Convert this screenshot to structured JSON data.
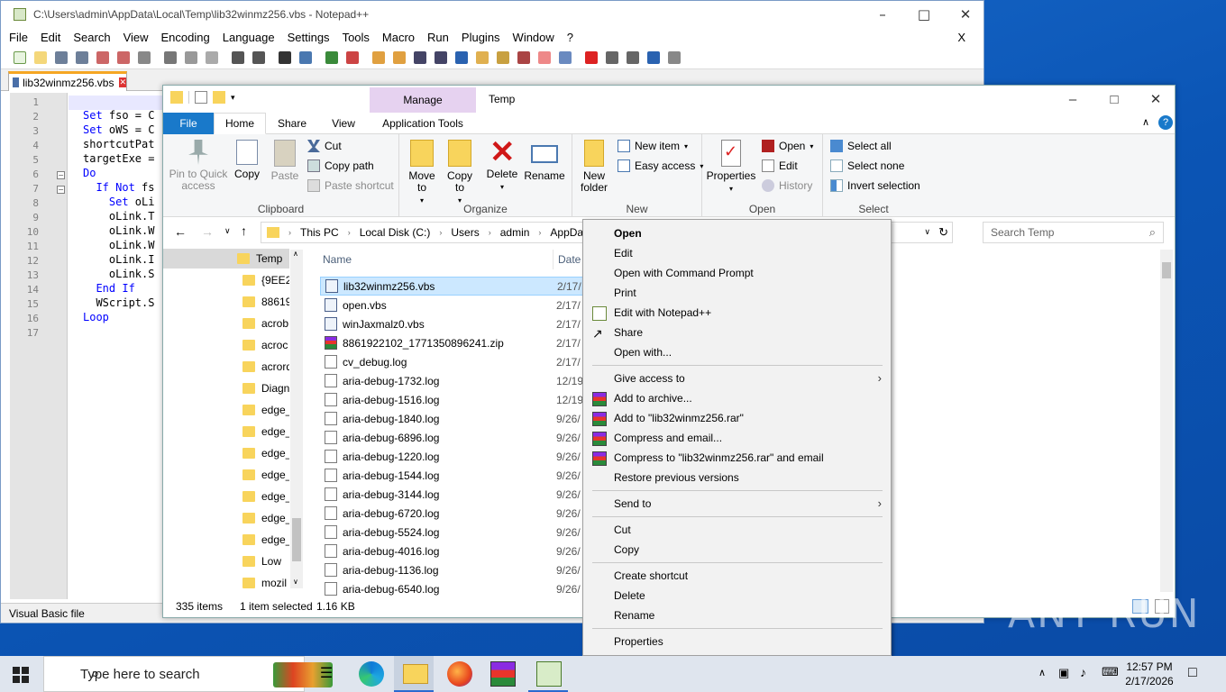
{
  "npp": {
    "title": "C:\\Users\\admin\\AppData\\Local\\Temp\\lib32winmz256.vbs - Notepad++",
    "menu": [
      "File",
      "Edit",
      "Search",
      "View",
      "Encoding",
      "Language",
      "Settings",
      "Tools",
      "Macro",
      "Run",
      "Plugins",
      "Window",
      "?"
    ],
    "menu_close": "X",
    "tab": "lib32winmz256.vbs",
    "line_numbers": [
      "1",
      "2",
      "3",
      "4",
      "5",
      "6",
      "7",
      "8",
      "9",
      "10",
      "11",
      "12",
      "13",
      "14",
      "15",
      "16",
      "17"
    ],
    "code_lines": [
      {
        "kw": "",
        "text": ""
      },
      {
        "kw": "Set",
        "text": " fso = C"
      },
      {
        "kw": "Set",
        "text": " oWS = C"
      },
      {
        "kw": "",
        "text": "shortcutPat"
      },
      {
        "kw": "",
        "text": "targetExe ="
      },
      {
        "kw": "Do",
        "text": ""
      },
      {
        "kw": "  If Not",
        "text": " fs"
      },
      {
        "kw": "    Set",
        "text": " oLi"
      },
      {
        "kw": "",
        "text": "    oLink.T"
      },
      {
        "kw": "",
        "text": "    oLink.W"
      },
      {
        "kw": "",
        "text": "    oLink.W"
      },
      {
        "kw": "",
        "text": "    oLink.I"
      },
      {
        "kw": "",
        "text": "    oLink.S"
      },
      {
        "kw": "  End If",
        "text": ""
      },
      {
        "kw": "",
        "text": "  WScript.S"
      },
      {
        "kw": "Loop",
        "text": ""
      },
      {
        "kw": "",
        "text": ""
      }
    ],
    "status_lang": "Visual Basic file"
  },
  "explorer": {
    "manage": "Manage",
    "title": "Temp",
    "tabs": {
      "file": "File",
      "home": "Home",
      "share": "Share",
      "view": "View",
      "app_tools": "Application Tools"
    },
    "clipboard": {
      "pin": "Pin to Quick access",
      "copy": "Copy",
      "paste": "Paste",
      "cut": "Cut",
      "copy_path": "Copy path",
      "paste_shortcut": "Paste shortcut",
      "label": "Clipboard"
    },
    "organize": {
      "move_to": "Move to",
      "copy_to": "Copy to",
      "delete": "Delete",
      "rename": "Rename",
      "label": "Organize"
    },
    "new": {
      "new_folder": "New folder",
      "new_item": "New item",
      "easy_access": "Easy access",
      "label": "New"
    },
    "open": {
      "properties": "Properties",
      "open": "Open",
      "edit": "Edit",
      "history": "History",
      "label": "Open"
    },
    "select": {
      "select_all": "Select all",
      "select_none": "Select none",
      "invert": "Invert selection",
      "label": "Select"
    },
    "breadcrumb": [
      "This PC",
      "Local Disk (C:)",
      "Users",
      "admin",
      "AppData"
    ],
    "search_placeholder": "Search Temp",
    "nav_items": [
      "Temp",
      "{9EE29",
      "88619",
      "acrob",
      "acroc",
      "acrord",
      "Diagn",
      "edge_",
      "edge_",
      "edge_",
      "edge_",
      "edge_",
      "edge_",
      "edge_",
      "Low",
      "mozil"
    ],
    "columns": {
      "name": "Name",
      "date": "Date"
    },
    "files": [
      {
        "name": "lib32winmz256.vbs",
        "date": "2/17/",
        "type": "vbs"
      },
      {
        "name": "open.vbs",
        "date": "2/17/",
        "type": "vbs"
      },
      {
        "name": "winJaxmalz0.vbs",
        "date": "2/17/",
        "type": "vbs"
      },
      {
        "name": "8861922102_1771350896241.zip",
        "date": "2/17/",
        "type": "zip"
      },
      {
        "name": "cv_debug.log",
        "date": "2/17/",
        "type": "log"
      },
      {
        "name": "aria-debug-1732.log",
        "date": "12/19",
        "type": "log"
      },
      {
        "name": "aria-debug-1516.log",
        "date": "12/19",
        "type": "log"
      },
      {
        "name": "aria-debug-1840.log",
        "date": "9/26/",
        "type": "log"
      },
      {
        "name": "aria-debug-6896.log",
        "date": "9/26/",
        "type": "log"
      },
      {
        "name": "aria-debug-1220.log",
        "date": "9/26/",
        "type": "log"
      },
      {
        "name": "aria-debug-1544.log",
        "date": "9/26/",
        "type": "log"
      },
      {
        "name": "aria-debug-3144.log",
        "date": "9/26/",
        "type": "log"
      },
      {
        "name": "aria-debug-6720.log",
        "date": "9/26/",
        "type": "log"
      },
      {
        "name": "aria-debug-5524.log",
        "date": "9/26/",
        "type": "log"
      },
      {
        "name": "aria-debug-4016.log",
        "date": "9/26/",
        "type": "log"
      },
      {
        "name": "aria-debug-1136.log",
        "date": "9/26/",
        "type": "log"
      },
      {
        "name": "aria-debug-6540.log",
        "date": "9/26/",
        "type": "log"
      }
    ],
    "status": {
      "items": "335 items",
      "selected": "1 item selected",
      "size": "1.16 KB"
    }
  },
  "context_menu": {
    "open": "Open",
    "edit": "Edit",
    "open_cmd": "Open with Command Prompt",
    "print": "Print",
    "edit_npp": "Edit with Notepad++",
    "share": "Share",
    "open_with": "Open with...",
    "give_access": "Give access to",
    "add_archive": "Add to archive...",
    "add_rar": "Add to \"lib32winmz256.rar\"",
    "compress_email": "Compress and email...",
    "compress_rar_email": "Compress to \"lib32winmz256.rar\" and email",
    "restore": "Restore previous versions",
    "send_to": "Send to",
    "cut": "Cut",
    "copy": "Copy",
    "create_shortcut": "Create shortcut",
    "delete": "Delete",
    "rename": "Rename",
    "properties": "Properties"
  },
  "taskbar": {
    "search": "Type here to search",
    "time": "12:57 PM",
    "date": "2/17/2026"
  },
  "watermark": "ANY RUN"
}
